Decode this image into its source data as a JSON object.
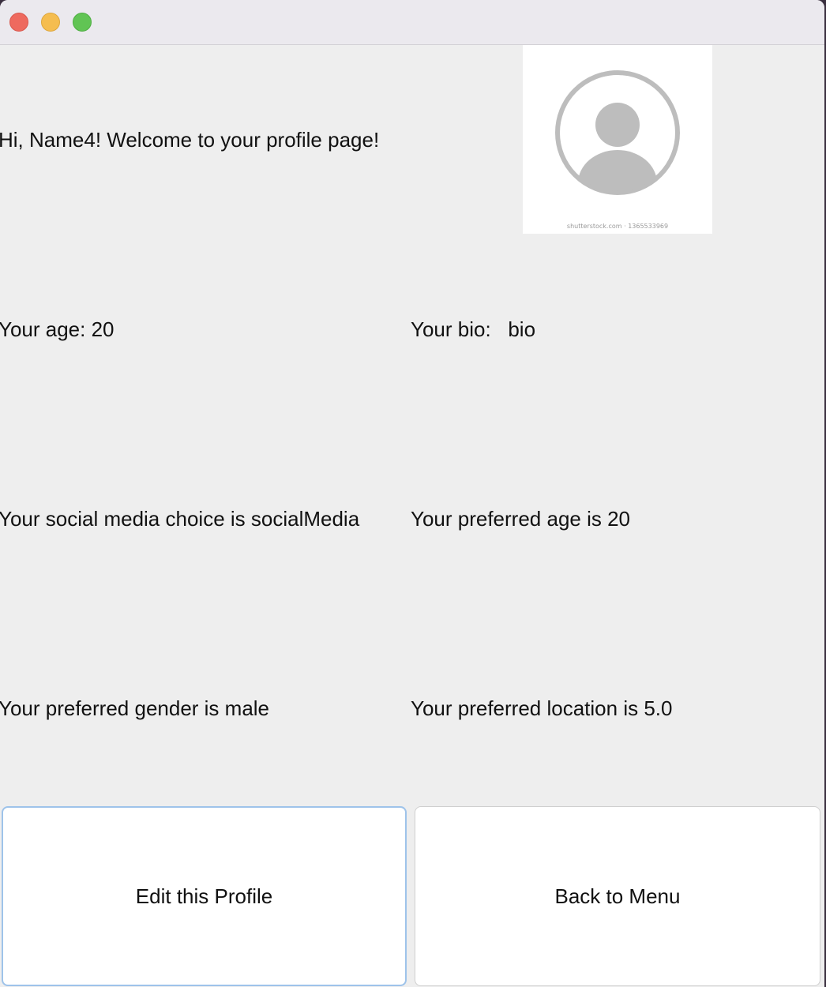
{
  "window": {
    "colors": {
      "close": "#ee6a5f",
      "minimize": "#f5bd4f",
      "maximize": "#61c454",
      "background": "#eeeeee",
      "focus_ring": "#9ec3ea"
    }
  },
  "profile": {
    "welcome": "Hi, Name4! Welcome to your profile page!",
    "avatar_caption": "shutterstock.com · 1365533969",
    "age": "Your age: 20",
    "bio": "Your bio:   bio",
    "social_media": "Your social media choice is socialMedia",
    "preferred_age": "Your preferred age is 20",
    "preferred_gender": "Your preferred gender is male",
    "preferred_location": "Your preferred location is 5.0"
  },
  "buttons": {
    "edit_label": "Edit this Profile",
    "back_label": "Back to Menu"
  }
}
